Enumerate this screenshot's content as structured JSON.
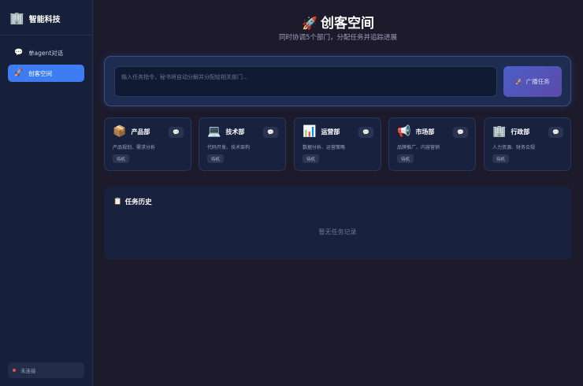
{
  "sidebar": {
    "brand": {
      "icon": "office-building-icon",
      "icon_glyph": "🏢",
      "name": "智能科技"
    },
    "items": [
      {
        "icon": "chat-bubble-icon",
        "icon_glyph": "💬",
        "label": "单agent对话",
        "active": false
      },
      {
        "icon": "rocket-icon",
        "icon_glyph": "🚀",
        "label": "创客空间",
        "active": true
      }
    ],
    "status": {
      "label": "未连接",
      "color": "#e35454"
    }
  },
  "header": {
    "icon_glyph": "🚀",
    "title": "创客空间",
    "subtitle": "同时协调5个部门，分配任务并追踪进展"
  },
  "task": {
    "placeholder": "输入任务指令，秘书将自动分解并分配给相关部门...",
    "button_icon_glyph": "🚀",
    "button_label": "广播任务"
  },
  "departments": [
    {
      "icon": "package-icon",
      "icon_glyph": "📦",
      "name": "产品部",
      "desc": "产品规划、需求分析",
      "status": "待机"
    },
    {
      "icon": "laptop-icon",
      "icon_glyph": "💻",
      "name": "技术部",
      "desc": "代码开发、技术架构",
      "status": "待机"
    },
    {
      "icon": "chart-icon",
      "icon_glyph": "📊",
      "name": "运营部",
      "desc": "数据分析、运营策略",
      "status": "待机"
    },
    {
      "icon": "megaphone-icon",
      "icon_glyph": "📢",
      "name": "市场部",
      "desc": "品牌推广、内容营销",
      "status": "待机"
    },
    {
      "icon": "office-building-icon",
      "icon_glyph": "🏢",
      "name": "行政部",
      "desc": "人力资源、财务合规",
      "status": "待机"
    }
  ],
  "history": {
    "icon_glyph": "📋",
    "title": "任务历史",
    "empty_text": "暂无任务记录"
  },
  "colors": {
    "accent": "#3d7cf2",
    "background": "#1c1a2b",
    "sidebar": "#17203a",
    "card": "#18223f"
  }
}
